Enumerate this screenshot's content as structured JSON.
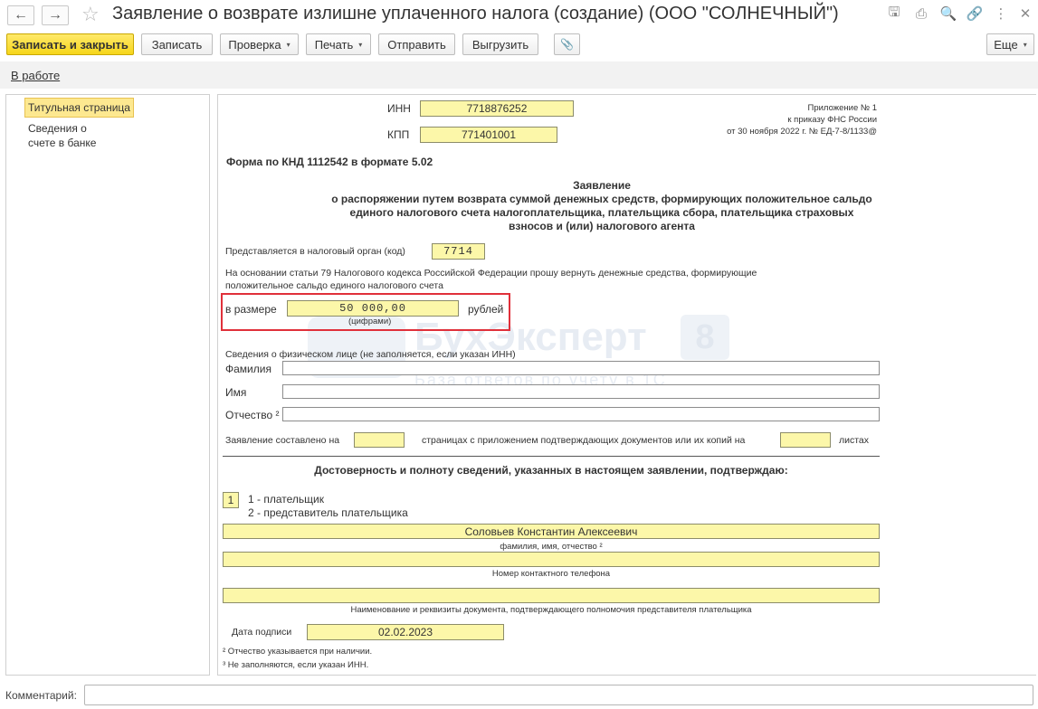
{
  "window": {
    "title": "Заявление о возврате излишне уплаченного налога (создание) (ООО \"СОЛНЕЧНЫЙ\")",
    "back_icon": "←",
    "forward_icon": "→",
    "favorite_icon": "☆",
    "top_icons": {
      "save": "🖫",
      "print": "⎙",
      "preview": "🔍",
      "link": "🔗",
      "more": "⋮",
      "close": "✕"
    }
  },
  "toolbar": {
    "save_close": "Записать и закрыть",
    "save": "Записать",
    "check": "Проверка",
    "print": "Печать",
    "send": "Отправить",
    "upload": "Выгрузить",
    "attach_icon": "📎",
    "more": "Еще",
    "caret": "▾"
  },
  "status": {
    "in_work": "В работе"
  },
  "nav": {
    "items": [
      {
        "label": "Титульная страница"
      },
      {
        "label": "Сведения о\nсчете в банке"
      }
    ]
  },
  "form": {
    "inn_label": "ИНН",
    "inn_value": "7718876252",
    "kpp_label": "КПП",
    "kpp_value": "771401001",
    "appendix": [
      "Приложение № 1",
      "к приказу ФНС России",
      "от 30 ноября 2022 г. №  ЕД-7-8/1133@"
    ],
    "form_code": "Форма по КНД 1112542 в формате 5.02",
    "header_lines": [
      "Заявление",
      "о распоряжении путем возврата суммой денежных средств, формирующих положительное сальдо",
      "единого налогового счета налогоплательщика, плательщика сбора, плательщика страховых",
      "взносов и (или) налогового агента"
    ],
    "tax_authority_label": "Представляется в налоговый орган (код)",
    "tax_authority_value": "7714",
    "basis_lines": [
      "На основании статьи 79 Налогового кодекса Российской Федерации прошу вернуть денежные средства, формирующие",
      "положительное сальдо единого налогового счета"
    ],
    "amount_label": "в размере",
    "amount_value": "50 000,00",
    "amount_unit": "рублей",
    "amount_hint": "(цифрами)",
    "person_header": "Сведения о физическом лице (не заполняется, если указан ИНН)",
    "surname_label": "Фамилия",
    "name_label": "Имя",
    "patronymic_label": "Отчество ²",
    "pages_prefix": "Заявление составлено на",
    "pages_middle": "страницах с приложением подтверждающих документов или их копий на",
    "pages_suffix": "листах",
    "confirm_header": "Достоверность и полноту сведений, указанных в настоящем заявлении, подтверждаю:",
    "signer_type_value": "1",
    "signer_types": [
      "1 - плательщик",
      "2 - представитель плательщика"
    ],
    "fio_value": "Соловьев Константин Алексеевич",
    "fio_caption": "фамилия, имя, отчество ²",
    "phone_caption": "Номер контактного телефона",
    "document_caption": "Наименование и реквизиты документа, подтверждающего полномочия представителя плательщика",
    "sign_date_label": "Дата подписи",
    "sign_date_value": "02.02.2023",
    "footnotes": [
      "² Отчество указывается при наличии.",
      "³ Не заполняются, если указан ИНН."
    ]
  },
  "watermark": {
    "brand": "БухЭксперт",
    "number": "8",
    "tagline": "База ответов по учету в 1С"
  },
  "footer": {
    "comment_label": "Комментарий:"
  }
}
